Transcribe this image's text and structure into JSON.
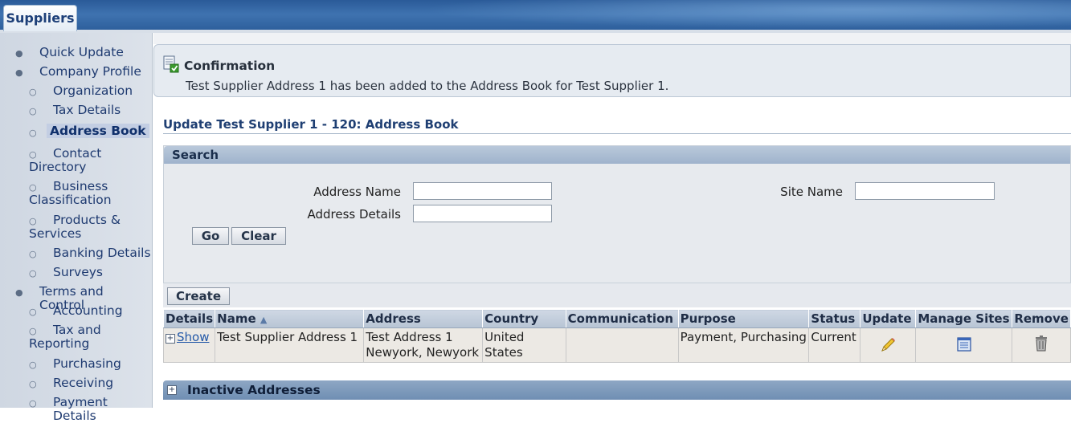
{
  "app": {
    "tab_label": "Suppliers"
  },
  "sidebar": {
    "items": [
      {
        "label": "Quick Update",
        "level": 1
      },
      {
        "label": "Company Profile",
        "level": 1
      },
      {
        "label": "Organization",
        "level": 2
      },
      {
        "label": "Tax Details",
        "level": 2
      },
      {
        "label": "Address Book",
        "level": 2,
        "selected": true
      },
      {
        "label": "Contact Directory",
        "level": 2
      },
      {
        "label": "Business Classification",
        "level": 2
      },
      {
        "label": "Products & Services",
        "level": 2
      },
      {
        "label": "Banking Details",
        "level": 2
      },
      {
        "label": "Surveys",
        "level": 2
      },
      {
        "label": "Terms and Control",
        "level": 1
      },
      {
        "label": "Accounting",
        "level": 2
      },
      {
        "label": "Tax and Reporting",
        "level": 2
      },
      {
        "label": "Purchasing",
        "level": 2
      },
      {
        "label": "Receiving",
        "level": 2
      },
      {
        "label": "Payment Details",
        "level": 2
      }
    ]
  },
  "confirmation": {
    "title": "Confirmation",
    "message": "Test Supplier Address 1 has been added to the Address Book for Test Supplier 1."
  },
  "page": {
    "title": "Update Test Supplier 1 - 120: Address Book"
  },
  "search": {
    "header": "Search",
    "address_name_label": "Address Name",
    "address_details_label": "Address Details",
    "site_name_label": "Site Name",
    "address_name_value": "",
    "address_details_value": "",
    "site_name_value": "",
    "go_label": "Go",
    "clear_label": "Clear"
  },
  "actions": {
    "create_label": "Create"
  },
  "table": {
    "headers": {
      "details": "Details",
      "name": "Name",
      "address": "Address",
      "country": "Country",
      "communication": "Communication",
      "purpose": "Purpose",
      "status": "Status",
      "update": "Update",
      "manage_sites": "Manage Sites",
      "remove": "Remove"
    },
    "sort_indicator": "▲",
    "rows": [
      {
        "details": "Show",
        "name": "Test Supplier Address 1",
        "address_line1": "Test Address 1",
        "address_line2": "Newyork, Newyork",
        "country": "United States",
        "communication": "",
        "purpose": "Payment, Purchasing",
        "status": "Current"
      }
    ]
  },
  "inactive": {
    "label": "Inactive Addresses"
  },
  "icons": {
    "update": "pencil-icon",
    "manage_sites": "manage-sites-icon",
    "remove": "trash-icon",
    "confirmation": "confirmation-icon"
  }
}
